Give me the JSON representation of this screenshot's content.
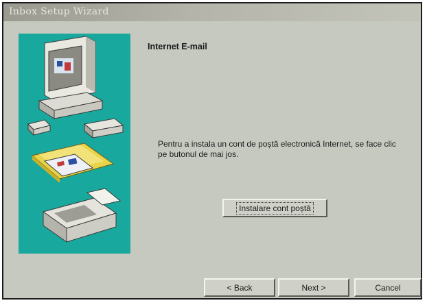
{
  "window": {
    "title": "Inbox Setup Wizard"
  },
  "page": {
    "heading": "Internet E-mail",
    "description": "Pentru a instala un cont de poștă electronică Internet, se face clic pe butonul de mai jos.",
    "install_button": "Instalare cont poștă"
  },
  "footer": {
    "back_label": "< Back",
    "next_label": "Next >",
    "cancel_label": "Cancel"
  },
  "illustration": {
    "icon": "computer-devices-illustration",
    "background_color": "#19a89d"
  }
}
